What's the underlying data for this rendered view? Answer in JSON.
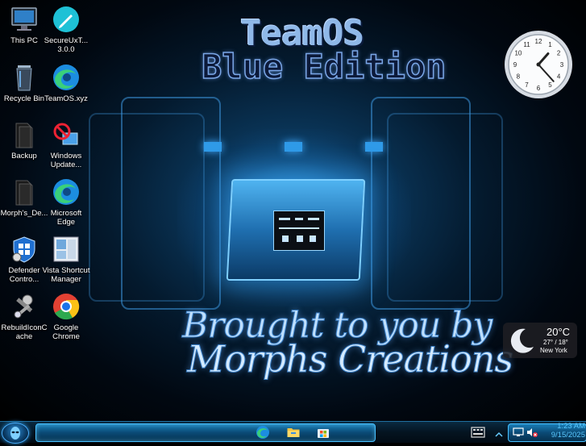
{
  "wallpaper": {
    "title_line1": "TeamOS",
    "title_line2": "Blue Edition",
    "credit_line1": "Brought to you by",
    "credit_line2": "Morphs Creations"
  },
  "desktop_icons": [
    {
      "label": "This PC",
      "icon": "monitor-icon"
    },
    {
      "label": "SecureUxT... 3.0.0",
      "icon": "pen-icon"
    },
    {
      "label": "Recycle Bin",
      "icon": "recycle-bin-icon"
    },
    {
      "label": "TeamOS.xyz",
      "icon": "edge-icon"
    },
    {
      "label": "Backup",
      "icon": "folder-icon"
    },
    {
      "label": "Windows Update...",
      "icon": "update-blocked-icon"
    },
    {
      "label": "Morph's_De...",
      "icon": "folder-icon"
    },
    {
      "label": "Microsoft Edge",
      "icon": "edge-icon"
    },
    {
      "label": "Defender Contro...",
      "icon": "defender-icon"
    },
    {
      "label": "Vista Shortcut Manager",
      "icon": "shortcut-manager-icon"
    },
    {
      "label": "RebuildIconC ache",
      "icon": "tools-icon"
    },
    {
      "label": "Google Chrome",
      "icon": "chrome-icon"
    }
  ],
  "clock_gadget": {
    "numbers": [
      "12",
      "1",
      "2",
      "3",
      "4",
      "5",
      "6",
      "7",
      "8",
      "9",
      "10",
      "11"
    ],
    "hour": 1,
    "minute": 23
  },
  "weather_gadget": {
    "temperature": "20°C",
    "high_low": "27° / 18°",
    "city": "New York",
    "icon": "moon-icon"
  },
  "taskbar": {
    "pinned": [
      "edge-icon",
      "file-explorer-icon",
      "store-icon"
    ],
    "tray_icons": [
      "keyboard-icon",
      "network-icon",
      "volume-muted-icon"
    ],
    "time": "1:23 AM",
    "date": "9/15/2025"
  },
  "colors": {
    "accent": "#2a9be8",
    "clock_text": "#59c8ff"
  }
}
